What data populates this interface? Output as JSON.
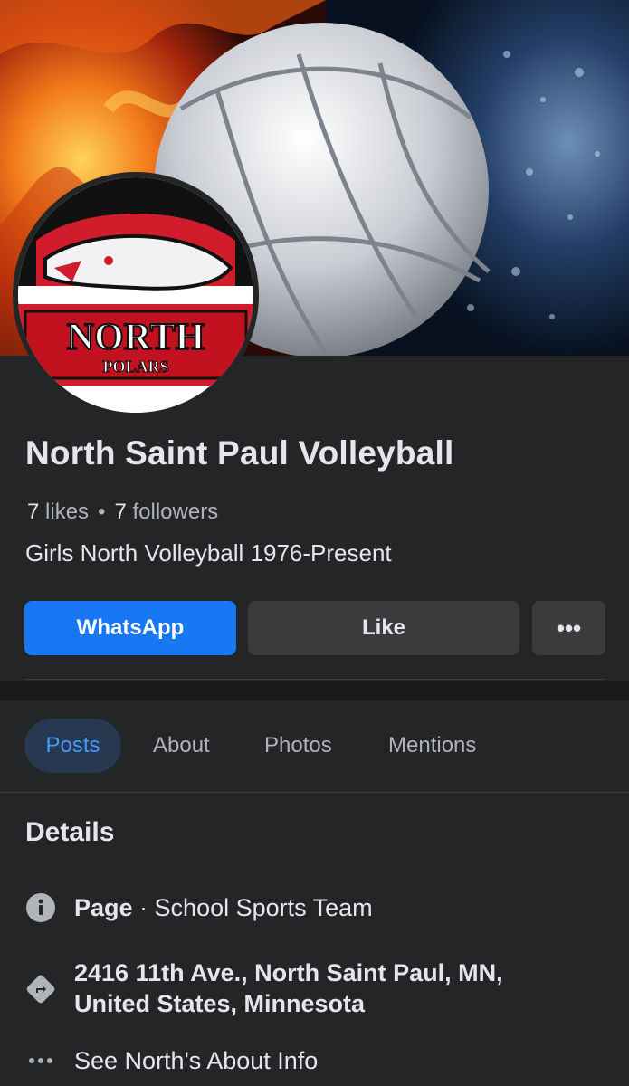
{
  "page": {
    "name": "North Saint Paul Volleyball",
    "likes_count": "7",
    "likes_label": "likes",
    "separator": "•",
    "followers_count": "7",
    "followers_label": "followers",
    "bio": "Girls North Volleyball 1976-Present"
  },
  "avatar": {
    "logo_text_main": "NORTH",
    "logo_text_sub": "POLARS"
  },
  "actions": {
    "whatsapp_label": "WhatsApp",
    "like_label": "Like",
    "more_label": "•••"
  },
  "tabs": [
    {
      "label": "Posts",
      "active": true
    },
    {
      "label": "About"
    },
    {
      "label": "Photos"
    },
    {
      "label": "Mentions"
    }
  ],
  "details": {
    "title": "Details",
    "category_prefix": "Page",
    "category": " · School Sports Team",
    "address_line1": "2416 11th Ave., North Saint Paul, MN,",
    "address_line2": "United States, Minnesota",
    "about_link": "See North's About Info"
  },
  "icons": {
    "category": "info-icon",
    "address": "directions-icon",
    "about": "more-dots-icon"
  },
  "colors": {
    "accent": "#1877f2",
    "background": "#242526",
    "active_tab_bg": "#263951",
    "active_tab_text": "#4599ff",
    "secondary_button": "#3a3b3c"
  }
}
